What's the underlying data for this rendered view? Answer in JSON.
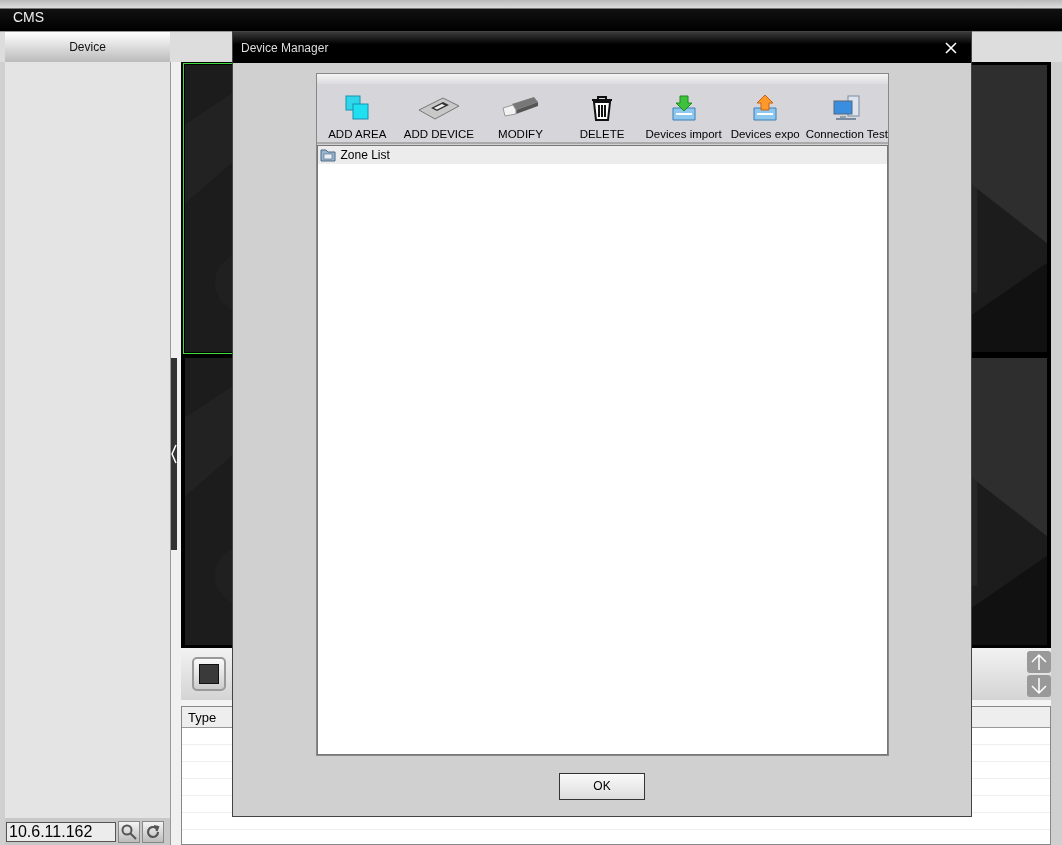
{
  "window": {
    "title": "CMS"
  },
  "tabs": [
    {
      "label": "Device",
      "selected": true
    }
  ],
  "video_tiles": [
    {
      "selected": true
    },
    {
      "selected": false
    },
    {
      "selected": false
    },
    {
      "selected": false
    }
  ],
  "table": {
    "columns": [
      "Type"
    ]
  },
  "sidebar": {
    "ip_field": {
      "value": "10.6.11.162"
    }
  },
  "dialog": {
    "title": "Device Manager",
    "toolbar": [
      {
        "label": "ADD AREA",
        "kind": "add-area"
      },
      {
        "label": "ADD DEVICE",
        "kind": "add-device"
      },
      {
        "label": "MODIFY",
        "kind": "modify"
      },
      {
        "label": "DELETE",
        "kind": "delete"
      },
      {
        "label": "Devices import",
        "kind": "import"
      },
      {
        "label": "Devices expo",
        "kind": "export"
      },
      {
        "label": "Connection  Test",
        "kind": "connection-test"
      }
    ],
    "tree": [
      {
        "label": "Zone List",
        "selected": true
      }
    ],
    "buttons": [
      "OK"
    ]
  }
}
